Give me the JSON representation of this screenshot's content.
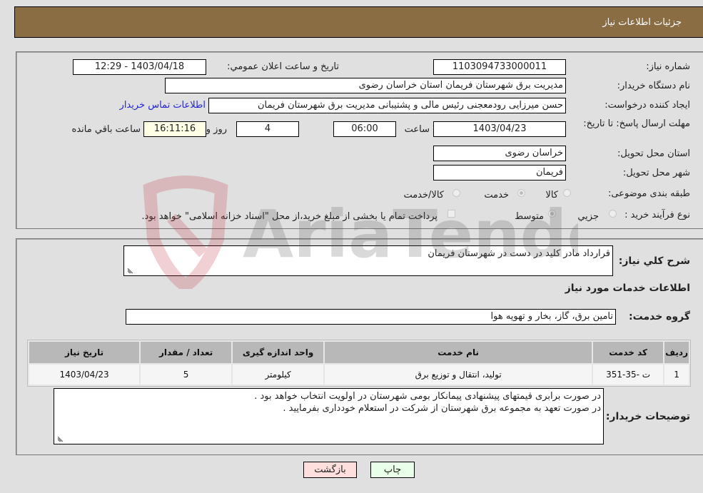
{
  "header": {
    "title": "جزئیات اطلاعات نیاز"
  },
  "fields": {
    "need_number_label": "شماره نیاز:",
    "need_number": "1103094733000011",
    "announce_label": "تاریخ و ساعت اعلان عمومي:",
    "announce_value": "1403/04/18 - 12:29",
    "buyer_org_label": "نام دستگاه خریدار:",
    "buyer_org": "مدیریت برق شهرستان فریمان استان خراسان رضوی",
    "creator_label": "ایجاد کننده درخواست:",
    "creator": "حسن میرزایی رودمعجنی رئیس مالی و پشتیبانی مدیریت برق شهرستان فریمان",
    "contact_link": "اطلاعات تماس خریدار",
    "deadline_label": "مهلت ارسال پاسخ: تا تاریخ:",
    "deadline_date": "1403/04/23",
    "time_label": "ساعت",
    "deadline_time": "06:00",
    "days_value": "4",
    "days_label": "روز و",
    "remaining_time": "16:11:16",
    "remaining_label": "ساعت باقي مانده",
    "province_label": "استان محل تحویل:",
    "province": "خراسان رضوی",
    "city_label": "شهر محل تحویل:",
    "city": "فریمان",
    "category_label": "طبقه بندی موضوعی:",
    "category_options": [
      "کالا",
      "خدمت",
      "کالا/خدمت"
    ],
    "category_selected": "خدمت",
    "process_label": "نوع فرآیند خرید :",
    "process_options": [
      "جزيي",
      "متوسط"
    ],
    "process_selected": "متوسط",
    "treasury_note": "پرداخت تمام یا بخشی از مبلغ خرید،از محل \"اسناد خزانه اسلامی\" خواهد بود."
  },
  "details": {
    "summary_label": "شرح کلي نیاز:",
    "summary": "قرارداد مادر کلید در دست در شهرستان فریمان",
    "services_heading": "اطلاعات خدمات مورد نیاز",
    "service_group_label": "گروه خدمت:",
    "service_group": "تامین برق، گاز، بخار و تهویه هوا",
    "table": {
      "headers": [
        "ردیف",
        "کد خدمت",
        "نام خدمت",
        "واحد اندازه گیری",
        "تعداد / مقدار",
        "تاریخ نیاز"
      ],
      "rows": [
        [
          "1",
          "ت -35-351",
          "تولید، انتقال و توزیع برق",
          "کیلومتر",
          "5",
          "1403/04/23"
        ]
      ]
    },
    "buyer_notes_label": "توضیحات خریدار:",
    "buyer_notes_line1": "در صورت برابری قیمتهای پیشنهادی پیمانکار بومی شهرستان در اولویت انتخاب خواهد بود .",
    "buyer_notes_line2": "در صورت تعهد به مجموعه برق شهرستان از شرکت در استعلام خودداری بفرمایید ."
  },
  "buttons": {
    "print": "چاپ",
    "back": "بازگشت"
  },
  "watermark": {
    "text": "AriaTender.neT"
  },
  "colors": {
    "header_bg": "#8b6d43",
    "print_bg": "#eaffea",
    "back_bg": "#ffdede",
    "link": "#2424d0"
  }
}
